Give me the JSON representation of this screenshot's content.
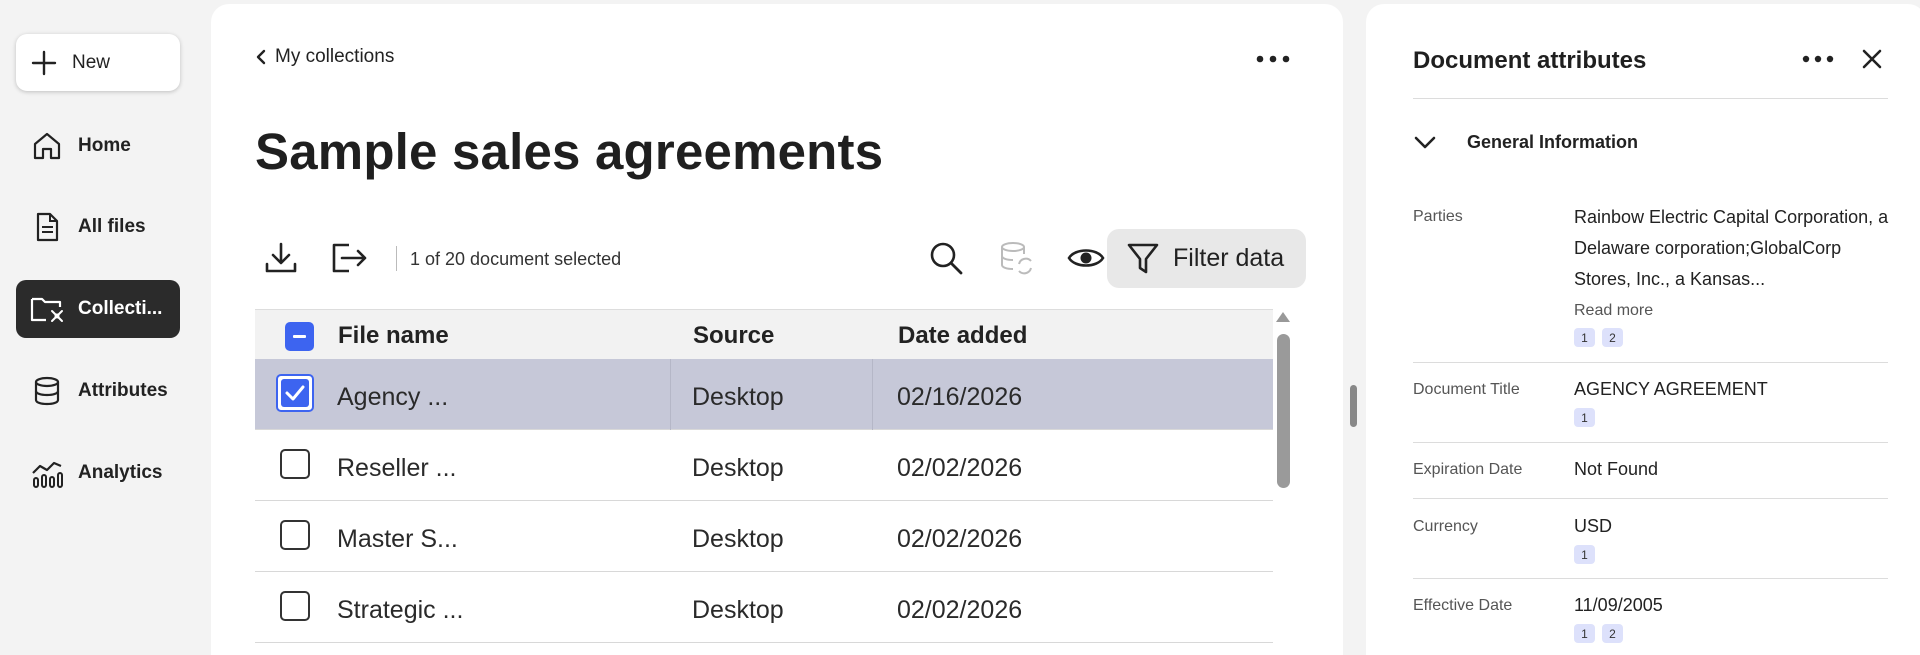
{
  "nav": {
    "new_label": "New",
    "items": [
      {
        "label": "Home",
        "icon": "home-icon"
      },
      {
        "label": "All files",
        "icon": "file-icon"
      },
      {
        "label": "Collecti...",
        "icon": "collection-folder-icon",
        "active": true
      },
      {
        "label": "Attributes",
        "icon": "database-icon"
      },
      {
        "label": "Analytics",
        "icon": "analytics-icon"
      }
    ]
  },
  "main": {
    "back_label": "My collections",
    "title": "Sample sales agreements",
    "selection_text": "1 of 20 document selected",
    "filter_label": "Filter data",
    "table": {
      "headers": [
        "File name",
        "Source",
        "Date added"
      ],
      "rows": [
        {
          "name": "Agency ...",
          "source": "Desktop",
          "date": "02/16/2026",
          "selected": true
        },
        {
          "name": "Reseller ...",
          "source": "Desktop",
          "date": "02/02/2026",
          "selected": false
        },
        {
          "name": "Master S...",
          "source": "Desktop",
          "date": "02/02/2026",
          "selected": false
        },
        {
          "name": "Strategic ...",
          "source": "Desktop",
          "date": "02/02/2026",
          "selected": false
        }
      ]
    }
  },
  "panel": {
    "title": "Document attributes",
    "section_title": "General Information",
    "read_more": "Read more",
    "attributes": [
      {
        "label": "Parties",
        "value": "Rainbow Electric Capital Corporation, a Delaware corporation;GlobalCorp Stores, Inc., a Kansas...",
        "chips": [
          "1",
          "2"
        ]
      },
      {
        "label": "Document Title",
        "value": "AGENCY AGREEMENT",
        "chips": [
          "1"
        ]
      },
      {
        "label": "Expiration Date",
        "value": "Not Found",
        "chips": []
      },
      {
        "label": "Currency",
        "value": "USD",
        "chips": [
          "1"
        ]
      },
      {
        "label": "Effective Date",
        "value": "11/09/2005",
        "chips": [
          "1",
          "2"
        ]
      }
    ]
  },
  "colors": {
    "accent": "#3d64f0",
    "selected_row": "#c6c8d8",
    "nav_active": "#2b2b2b",
    "chip_bg": "#dde1fb"
  }
}
